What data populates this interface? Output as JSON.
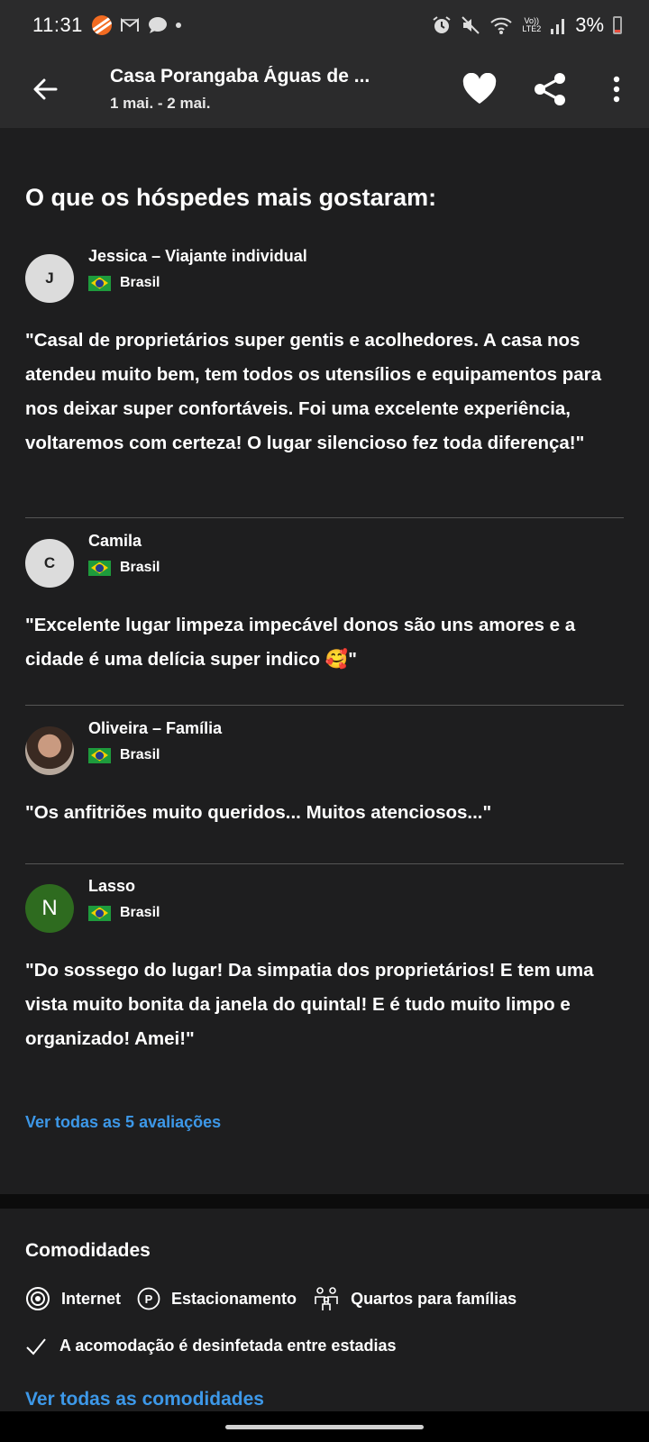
{
  "status_bar": {
    "time": "11:31",
    "network_label": "Vo))\nLTE2",
    "battery": "3%"
  },
  "app_bar": {
    "title": "Casa Porangaba Águas de ...",
    "dates": "1 mai. - 2 mai."
  },
  "reviews": {
    "title": "O que os hóspedes mais gostaram:",
    "items": [
      {
        "initial": "J",
        "name": "Jessica – Viajante individual",
        "country": "Brasil",
        "text": "\"Casal de proprietários super gentis e acolhedores. A casa nos atendeu muito bem, tem todos os utensílios e equipamentos para nos deixar super confortáveis. Foi uma excelente experiência, voltaremos com certeza! O lugar silencioso fez toda diferença!\""
      },
      {
        "initial": "C",
        "name": "Camila",
        "country": "Brasil",
        "text": "\"Excelente lugar limpeza impecável donos são uns amores e a cidade é uma delícia super indico 🥰\""
      },
      {
        "initial": "",
        "name": "Oliveira – Família",
        "country": "Brasil",
        "text": "\"Os anfitriões muito queridos... Muitos atenciosos...\""
      },
      {
        "initial": "N",
        "name": "Lasso",
        "country": "Brasil",
        "text": "\"Do sossego do lugar! Da simpatia dos proprietários! E tem uma vista muito bonita da janela do quintal! E é tudo muito limpo e organizado! Amei!\""
      }
    ],
    "see_all": "Ver todas as 5 avaliações"
  },
  "amenities": {
    "title": "Comodidades",
    "items": [
      {
        "label": "Internet",
        "icon": "wifi-icon"
      },
      {
        "label": "Estacionamento",
        "icon": "parking-icon"
      },
      {
        "label": "Quartos para famílias",
        "icon": "family-icon"
      }
    ],
    "disinfected": "A acomodação é desinfetada entre estadias",
    "see_all": "Ver todas as comodidades"
  },
  "colors": {
    "background": "#1e1e1f",
    "app_bar": "#2b2b2c",
    "link": "#3d98e8",
    "avatar_green": "#2e6b1f"
  }
}
